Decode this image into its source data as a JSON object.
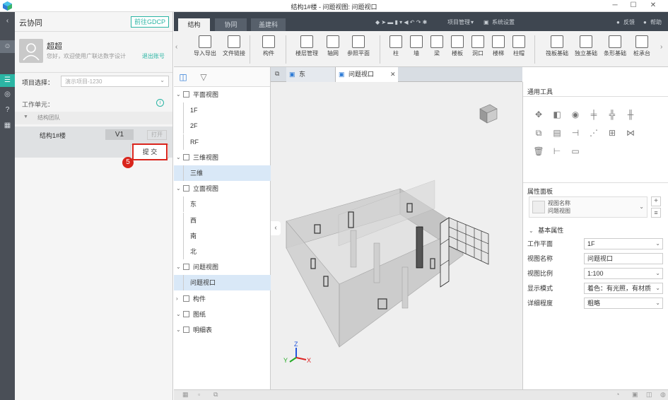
{
  "window": {
    "title": "结构1#楼 - 问题视图: 问题视口",
    "minimize": "─",
    "maximize": "☐",
    "close": "✕"
  },
  "cloud": {
    "title": "云协同",
    "gdcp_button": "前往GDCP",
    "user_name": "超超",
    "greeting": "您好，欢迎使用广联达数字设计",
    "logout": "退出账号",
    "project_label": "项目选择：",
    "project_placeholder": "演示项目-1230",
    "work_unit_label": "工作单元：",
    "team_label": "结构团队",
    "unit_name": "结构1#楼",
    "version": "V1",
    "open_button": "打开",
    "step_number": "5",
    "submit_button": "提 交"
  },
  "ribbon": {
    "tabs": [
      "结构",
      "协同",
      "盖建科"
    ],
    "quick_actions": [
      "项目管理",
      "系统设置"
    ],
    "right_links": [
      "反馈",
      "帮助"
    ],
    "tools": [
      "导入导出",
      "文件链接",
      "构件",
      "楼层管理",
      "轴网",
      "参照平面",
      "柱",
      "墙",
      "梁",
      "楼板",
      "洞口",
      "楼梯",
      "柱帽",
      "筏板基础",
      "独立基础",
      "条形基础",
      "桩承台"
    ]
  },
  "tree": {
    "nodes": [
      {
        "label": "平面视图",
        "level": 0
      },
      {
        "label": "1F",
        "level": 1
      },
      {
        "label": "2F",
        "level": 1
      },
      {
        "label": "RF",
        "level": 1
      },
      {
        "label": "三维视图",
        "level": 0
      },
      {
        "label": "三维",
        "level": 1
      },
      {
        "label": "立面视图",
        "level": 0
      },
      {
        "label": "东",
        "level": 1
      },
      {
        "label": "西",
        "level": 1
      },
      {
        "label": "南",
        "level": 1
      },
      {
        "label": "北",
        "level": 1
      },
      {
        "label": "问题视图",
        "level": 0
      },
      {
        "label": "问题视口",
        "level": 1
      },
      {
        "label": "构件",
        "level": 0
      },
      {
        "label": "图纸",
        "level": 0
      },
      {
        "label": "明细表",
        "level": 0
      }
    ]
  },
  "view_tabs": [
    "东",
    "问题视口"
  ],
  "general_tools_title": "通用工具",
  "properties": {
    "title": "属性面板",
    "view_name_label": "视图名称",
    "view_name_value": "问题视图",
    "section": "基本属性",
    "rows": [
      {
        "label": "工作平面",
        "value": "1F",
        "dropdown": true
      },
      {
        "label": "视图名称",
        "value": "问题视口",
        "dropdown": false
      },
      {
        "label": "视图比例",
        "value": "1:100",
        "dropdown": true
      },
      {
        "label": "显示模式",
        "value": "着色：有光照，有材质",
        "dropdown": true
      },
      {
        "label": "详细程度",
        "value": "粗略",
        "dropdown": true
      }
    ]
  },
  "colors": {
    "accent_teal": "#2bb5a4",
    "dark_toolbar": "#3e4650",
    "highlight": "#d9e8f7",
    "step_red": "#d9251c"
  }
}
